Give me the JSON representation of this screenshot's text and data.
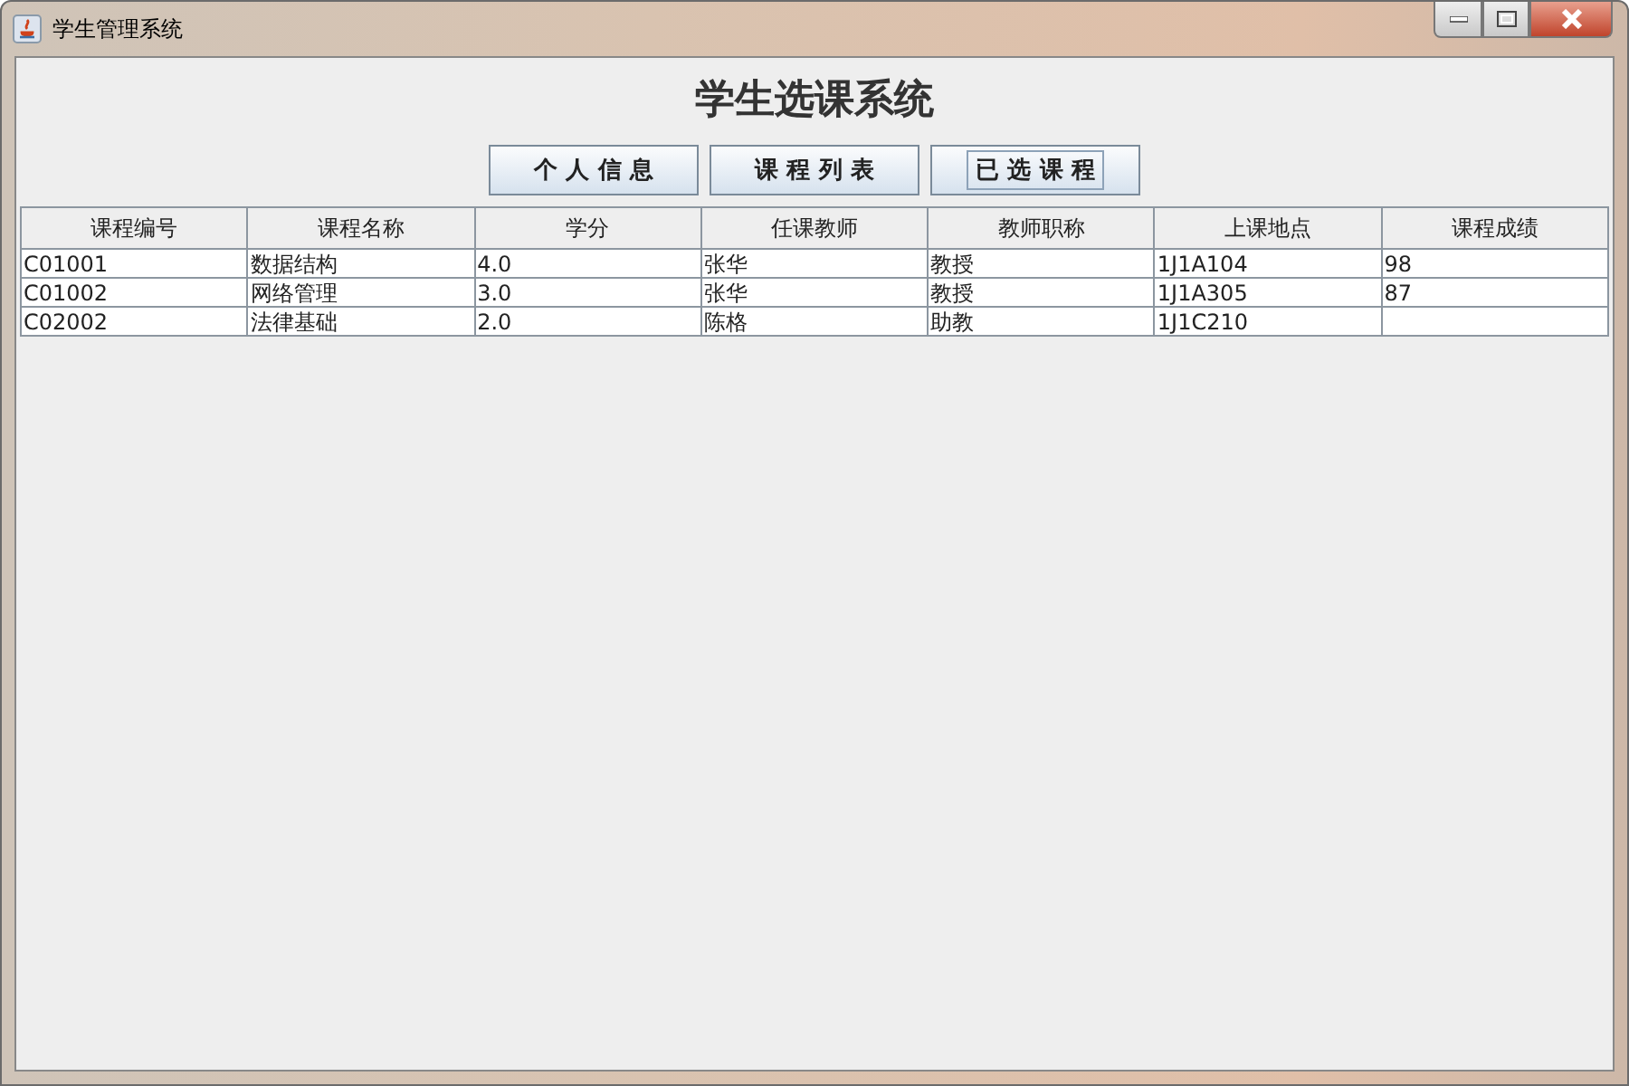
{
  "window": {
    "title": "学生管理系统"
  },
  "heading": "学生选课系统",
  "buttons": [
    {
      "label": "个 人 信 息",
      "focused": false
    },
    {
      "label": "课 程 列 表",
      "focused": false
    },
    {
      "label": "已 选 课 程",
      "focused": true
    }
  ],
  "table": {
    "columns": [
      "课程编号",
      "课程名称",
      "学分",
      "任课教师",
      "教师职称",
      "上课地点",
      "课程成绩"
    ],
    "rows": [
      [
        "C01001",
        "数据结构",
        "4.0",
        "张华",
        "教授",
        "1J1A104",
        "98"
      ],
      [
        "C01002",
        "网络管理",
        "3.0",
        "张华",
        "教授",
        "1J1A305",
        "87"
      ],
      [
        "C02002",
        "法律基础",
        "2.0",
        "陈格",
        "助教",
        "1J1C210"
      ]
    ]
  }
}
